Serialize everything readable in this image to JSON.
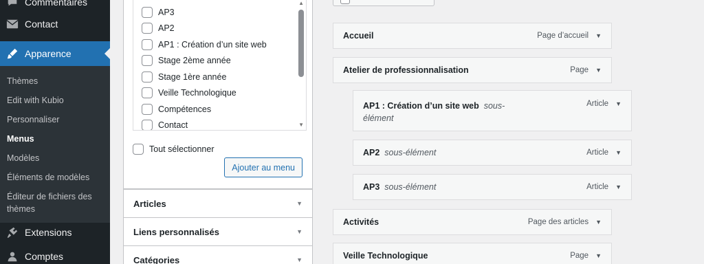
{
  "sidebar": {
    "top_items": [
      {
        "label": "Commentaires",
        "icon": "comment-icon"
      },
      {
        "label": "Contact",
        "icon": "mail-icon"
      }
    ],
    "active": {
      "label": "Apparence",
      "icon": "brush-icon"
    },
    "submenu": [
      "Thèmes",
      "Edit with Kubio",
      "Personnaliser",
      "Menus",
      "Modèles",
      "Éléments de modèles",
      "Éditeur de fichiers des thèmes"
    ],
    "bottom_items": [
      {
        "label": "Extensions",
        "icon": "plugin-icon"
      },
      {
        "label": "Comptes",
        "icon": "user-icon"
      }
    ]
  },
  "pages_panel": {
    "items": [
      "AP3",
      "AP2",
      "AP1 : Création d’un site web",
      "Stage 2ème année",
      "Stage 1ère année",
      "Veille Technologique",
      "Compétences",
      "Contact"
    ],
    "select_all": "Tout sélectionner",
    "add_button": "Ajouter au menu"
  },
  "accordions": [
    "Articles",
    "Liens personnalisés",
    "Catégories"
  ],
  "menu_structure": [
    {
      "title": "Accueil",
      "sub": "",
      "type": "Page d’accueil"
    },
    {
      "title": "Atelier de professionnalisation",
      "sub": "",
      "type": "Page"
    },
    {
      "title": "AP1 : Création d’un site web",
      "sub": "sous-élément",
      "type": "Article"
    },
    {
      "title": "AP2",
      "sub": "sous-élément",
      "type": "Article"
    },
    {
      "title": "AP3",
      "sub": "sous-élément",
      "type": "Article"
    },
    {
      "title": "Activités",
      "sub": "",
      "type": "Page des articles"
    },
    {
      "title": "Veille Technologique",
      "sub": "",
      "type": "Page"
    }
  ]
}
